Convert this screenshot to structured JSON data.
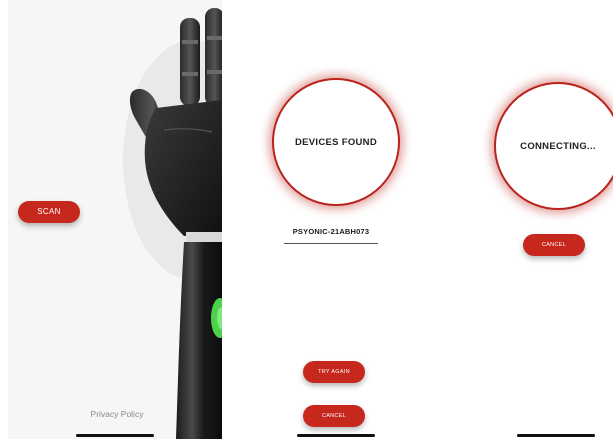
{
  "screen_scan": {
    "scan_label": "SCAN",
    "privacy_label": "Privacy Policy",
    "indicator_color": "#4ed14a"
  },
  "screen_found": {
    "heading": "DEVICES FOUND",
    "device_name": "PSYONIC-21ABH073",
    "try_again_label": "TRY AGAIN",
    "cancel_label": "CANCEL"
  },
  "screen_connecting": {
    "heading": "CONNECTING...",
    "cancel_label": "CANCEL"
  },
  "colors": {
    "accent": "#c6281e",
    "circle_border": "#b8241b"
  }
}
